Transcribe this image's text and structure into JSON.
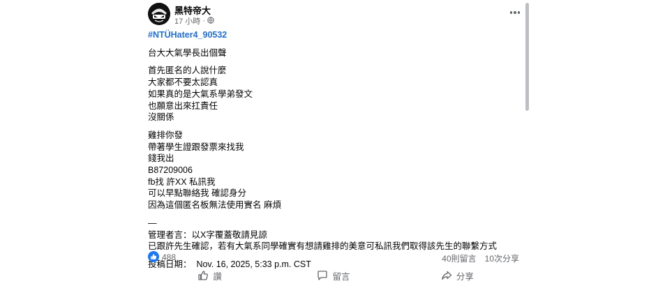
{
  "post": {
    "author": "黑特帝大",
    "time": "17 小時",
    "audience_icon": "globe-icon",
    "hashtag": "#NTÜHater4_90532",
    "paragraphs": [
      [
        "台大大氣學長出個聲"
      ],
      [
        "首先匿名的人說什麼",
        "大家都不要太認真",
        "如果真的是大氣系學弟發文",
        "也願意出來扛責任",
        "沒關係"
      ],
      [
        "雞排你發",
        "帶著學生證跟發票來找我",
        "錢我出",
        "B87209006",
        "fb找 許XX 私訊我",
        "可以早點聯絡我 確認身分",
        "因為這個匿名板無法使用實名 麻煩"
      ],
      [
        "—",
        "管理者言：以X字覆蓋敬請見諒",
        "已跟許先生確認，若有大氣系同學確實有想請雞排的美意可私訊我們取得該先生的聯繫方式"
      ],
      [
        "投稿日期：  Nov. 16, 2025, 5:33 p.m. CST"
      ]
    ],
    "like_count": "488",
    "comments": "40則留言",
    "shares": "10次分享"
  },
  "actions": {
    "like": "讚",
    "comment": "留言",
    "share": "分享"
  },
  "colors": {
    "link": "#216fdb",
    "like_blue": "#1877f2",
    "secondary_text": "#65676b"
  }
}
